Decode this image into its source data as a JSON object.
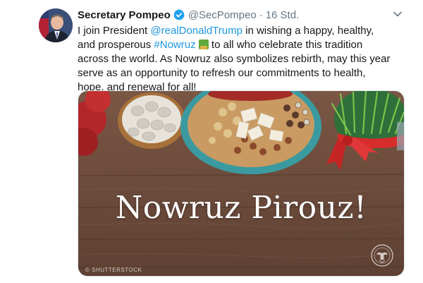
{
  "tweet": {
    "author_name": "Secretary Pompeo",
    "author_handle": "@SecPompeo",
    "separator": "·",
    "timestamp": "16 Std.",
    "text_part1": "I join President ",
    "mention": "@realDonaldTrump",
    "text_part2": " in wishing a happy, healthy, and prosperous ",
    "hashtag": "#Nowruz",
    "text_part3": " to all who celebrate this tradition across the world. As Nowruz also symbolizes rebirth, may this year serve as an opportunity to refresh our commitments to health, hope, and renewal for all!"
  },
  "media": {
    "banner_text": "Nowruz Pirouz!",
    "watermark": "© SHUTTERSTOCK"
  },
  "icons": {
    "verified": "verified-badge-icon",
    "menu": "chevron-down-icon",
    "emoji": "sabzeh-emoji-icon",
    "seal": "state-department-seal-icon"
  },
  "colors": {
    "link": "#1b95e0",
    "verified": "#1da1f2",
    "secondary_text": "#657786",
    "wood": "#6b4a3a"
  }
}
